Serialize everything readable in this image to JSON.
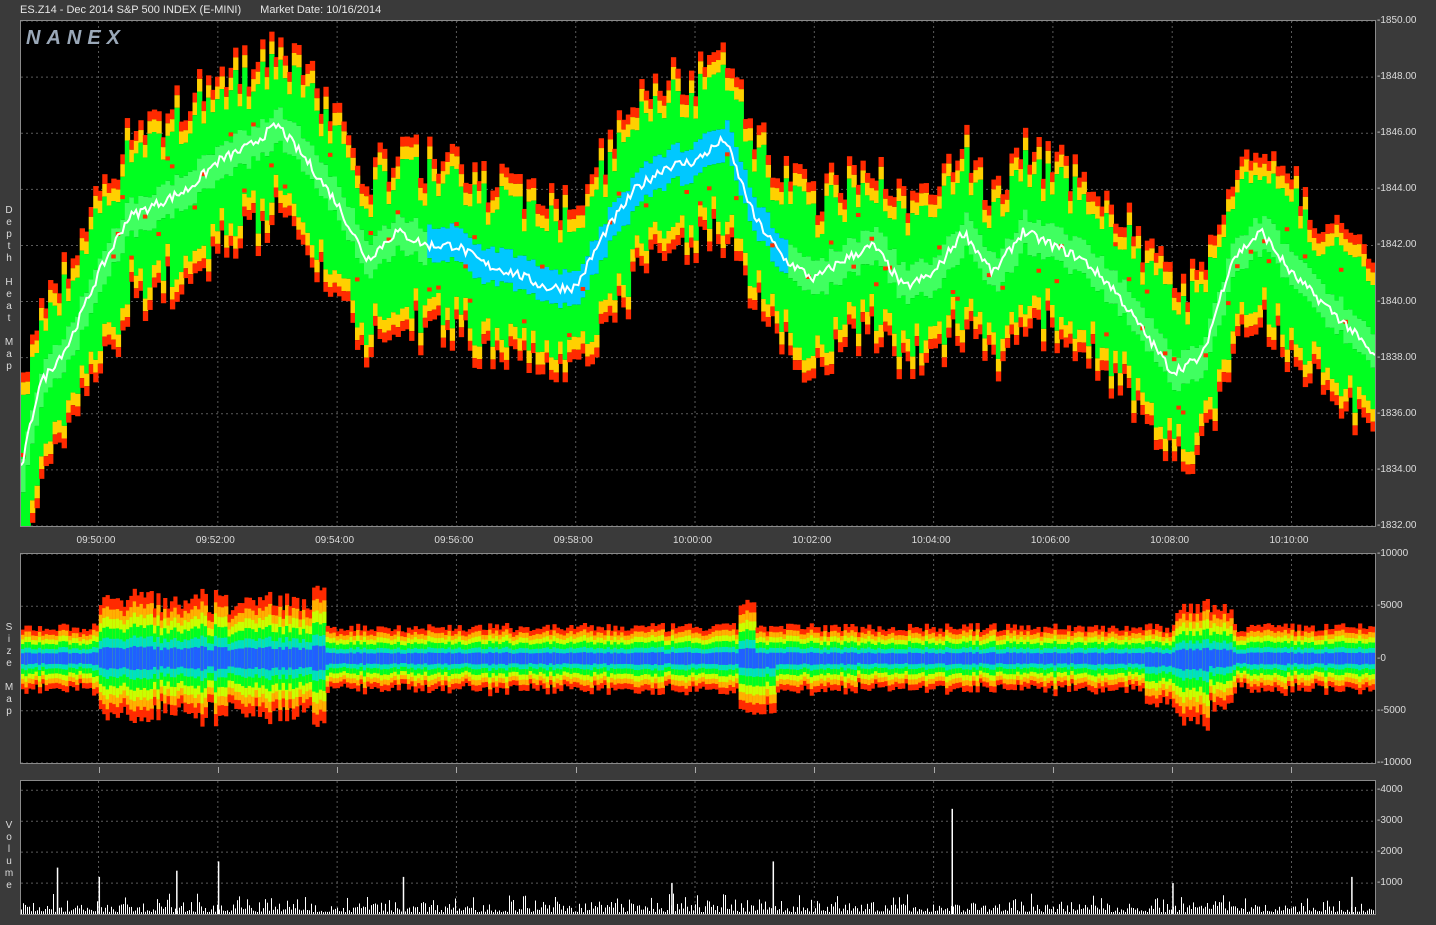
{
  "header": {
    "symbol": "ES.Z14 - Dec 2014 S&P 500 INDEX (E-MINI)",
    "market_date": "Market Date: 10/16/2014"
  },
  "watermark": "NANEX",
  "panels": {
    "depth_label": "Depth Heat Map",
    "size_label": "Size Map",
    "volume_label": "Volume"
  },
  "colors": {
    "background": "#000000",
    "grid": "#5a5a5a",
    "price_line": "#ffffff",
    "heat_high": "#ff2a00",
    "heat_mid": "#00ff20",
    "heat_low": "#00c8ff"
  },
  "chart_data": [
    {
      "type": "heatmap",
      "name": "depth-heat-map",
      "x_ticks": [
        "09:50:00",
        "09:52:00",
        "09:54:00",
        "09:56:00",
        "09:58:00",
        "10:00:00",
        "10:02:00",
        "10:04:00",
        "10:06:00",
        "10:08:00",
        "10:10:00"
      ],
      "x_tick_minutes": [
        2,
        4,
        6,
        8,
        10,
        12,
        14,
        16,
        18,
        20,
        22
      ],
      "xlim_minutes": [
        0.7,
        23.4
      ],
      "y_ticks": [
        "1850.00",
        "1848.00",
        "1846.00",
        "1844.00",
        "1842.00",
        "1840.00",
        "1838.00",
        "1836.00",
        "1834.00",
        "1832.00"
      ],
      "ylim": [
        1832,
        1850
      ],
      "price_minutes": [
        0.7,
        1.0,
        1.5,
        2.0,
        2.5,
        3.0,
        3.5,
        4.0,
        4.5,
        5.0,
        5.5,
        6.0,
        6.5,
        7.0,
        7.5,
        8.0,
        8.5,
        9.0,
        9.5,
        10.0,
        10.5,
        11.0,
        11.5,
        12.0,
        12.5,
        13.0,
        13.5,
        14.0,
        14.5,
        15.0,
        15.5,
        16.0,
        16.5,
        17.0,
        17.5,
        18.0,
        18.5,
        19.0,
        19.5,
        20.0,
        20.5,
        21.0,
        21.5,
        22.0,
        22.5,
        23.0,
        23.4
      ],
      "price_values": [
        1834.0,
        1837.0,
        1838.5,
        1841.0,
        1843.0,
        1843.5,
        1844.0,
        1845.0,
        1845.5,
        1846.3,
        1845.0,
        1843.5,
        1841.5,
        1842.5,
        1842.0,
        1842.0,
        1841.3,
        1841.0,
        1840.5,
        1840.5,
        1842.5,
        1844.0,
        1844.8,
        1845.0,
        1845.8,
        1843.0,
        1841.5,
        1840.8,
        1841.5,
        1842.0,
        1840.5,
        1841.0,
        1842.5,
        1841.0,
        1842.5,
        1842.0,
        1841.5,
        1840.5,
        1839.0,
        1837.5,
        1838.0,
        1841.5,
        1842.5,
        1841.0,
        1840.0,
        1839.0,
        1838.0
      ]
    },
    {
      "type": "heatmap",
      "name": "size-map",
      "y_ticks": [
        "10000",
        "5000",
        "0",
        "-5000",
        "-10000"
      ],
      "ylim": [
        -10000,
        10000
      ]
    },
    {
      "type": "bar",
      "name": "volume",
      "y_ticks": [
        "4000",
        "3000",
        "2000",
        "1000"
      ],
      "ylim": [
        0,
        4300
      ],
      "spikes": [
        {
          "minute": 1.3,
          "value": 1500
        },
        {
          "minute": 2.0,
          "value": 1200
        },
        {
          "minute": 3.3,
          "value": 1400
        },
        {
          "minute": 4.0,
          "value": 1700
        },
        {
          "minute": 7.1,
          "value": 1200
        },
        {
          "minute": 11.6,
          "value": 1000
        },
        {
          "minute": 13.3,
          "value": 1700
        },
        {
          "minute": 16.3,
          "value": 3400
        },
        {
          "minute": 20.0,
          "value": 1000
        },
        {
          "minute": 23.0,
          "value": 1200
        }
      ]
    }
  ]
}
